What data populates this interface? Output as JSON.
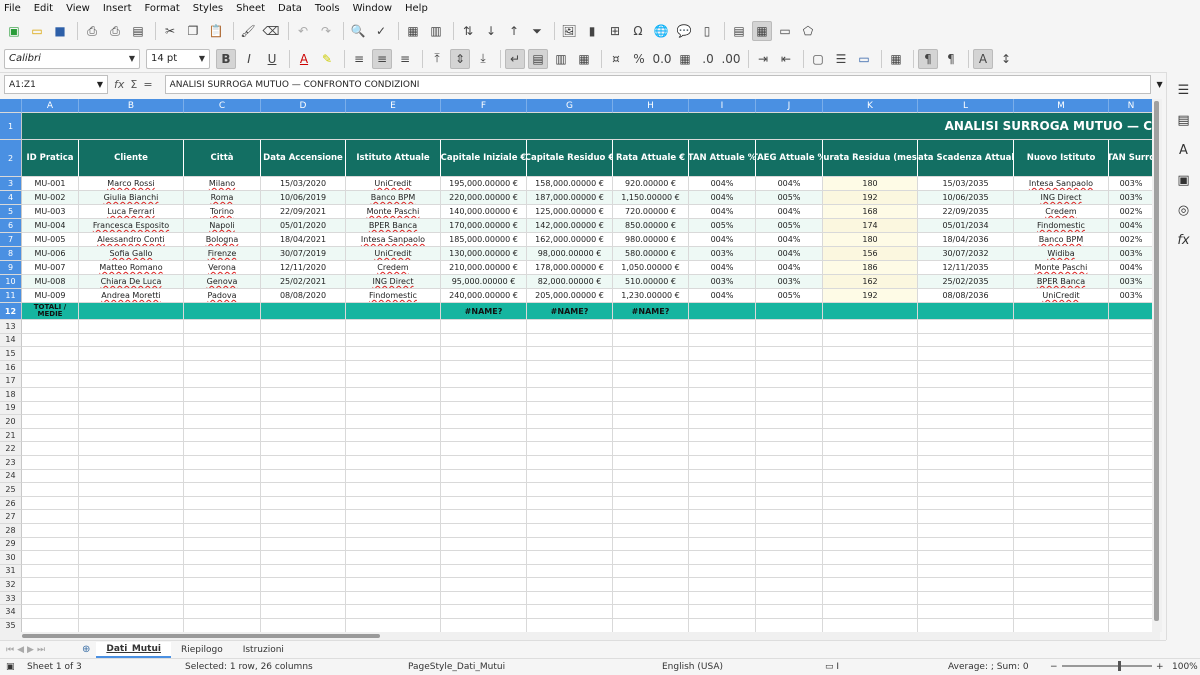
{
  "menu": [
    "File",
    "Edit",
    "View",
    "Insert",
    "Format",
    "Styles",
    "Sheet",
    "Data",
    "Tools",
    "Window",
    "Help"
  ],
  "format_bar": {
    "font_name": "Calibri",
    "font_size": "14 pt"
  },
  "formula_bar": {
    "cell_ref": "A1:Z1",
    "content": "ANALISI SURROGA MUTUO — CONFRONTO CONDIZIONI"
  },
  "columns": [
    "A",
    "B",
    "C",
    "D",
    "E",
    "F",
    "G",
    "H",
    "I",
    "J",
    "K",
    "L",
    "M",
    "N"
  ],
  "title": "ANALISI SURROGA MUTUO — C",
  "headers": [
    "ID Pratica",
    "Cliente",
    "Città",
    "Data Accensione",
    "Istituto Attuale",
    "Capitale Iniziale €",
    "Capitale Residuo €",
    "Rata Attuale €",
    "TAN Attuale %",
    "TAEG Attuale %",
    "Durata Residua (mesi)",
    "Data Scadenza Attuale",
    "Nuovo Istituto",
    "TAN Surro"
  ],
  "rows": [
    [
      "MU-001",
      "Marco Rossi",
      "Milano",
      "15/03/2020",
      "UniCredit",
      "195,000.00000 €",
      "158,000.00000 €",
      "920.00000 €",
      "004%",
      "004%",
      "180",
      "15/03/2035",
      "Intesa Sanpaolo",
      "003%"
    ],
    [
      "MU-002",
      "Giulia Bianchi",
      "Roma",
      "10/06/2019",
      "Banco BPM",
      "220,000.00000 €",
      "187,000.00000 €",
      "1,150.00000 €",
      "004%",
      "005%",
      "192",
      "10/06/2035",
      "ING Direct",
      "003%"
    ],
    [
      "MU-003",
      "Luca Ferrari",
      "Torino",
      "22/09/2021",
      "Monte Paschi",
      "140,000.00000 €",
      "125,000.00000 €",
      "720.00000 €",
      "004%",
      "004%",
      "168",
      "22/09/2035",
      "Credem",
      "002%"
    ],
    [
      "MU-004",
      "Francesca Esposito",
      "Napoli",
      "05/01/2020",
      "BPER Banca",
      "170,000.00000 €",
      "142,000.00000 €",
      "850.00000 €",
      "005%",
      "005%",
      "174",
      "05/01/2034",
      "Findomestic",
      "004%"
    ],
    [
      "MU-005",
      "Alessandro Conti",
      "Bologna",
      "18/04/2021",
      "Intesa Sanpaolo",
      "185,000.00000 €",
      "162,000.00000 €",
      "980.00000 €",
      "004%",
      "004%",
      "180",
      "18/04/2036",
      "Banco BPM",
      "002%"
    ],
    [
      "MU-006",
      "Sofia Gallo",
      "Firenze",
      "30/07/2019",
      "UniCredit",
      "130,000.00000 €",
      "98,000.00000 €",
      "580.00000 €",
      "003%",
      "004%",
      "156",
      "30/07/2032",
      "Widiba",
      "003%"
    ],
    [
      "MU-007",
      "Matteo Romano",
      "Verona",
      "12/11/2020",
      "Credem",
      "210,000.00000 €",
      "178,000.00000 €",
      "1,050.00000 €",
      "004%",
      "004%",
      "186",
      "12/11/2035",
      "Monte Paschi",
      "004%"
    ],
    [
      "MU-008",
      "Chiara De Luca",
      "Genova",
      "25/02/2021",
      "ING Direct",
      "95,000.00000 €",
      "82,000.00000 €",
      "510.00000 €",
      "003%",
      "003%",
      "162",
      "25/02/2035",
      "BPER Banca",
      "003%"
    ],
    [
      "MU-009",
      "Andrea Moretti",
      "Padova",
      "08/08/2020",
      "Findomestic",
      "240,000.00000 €",
      "205,000.00000 €",
      "1,230.00000 €",
      "004%",
      "005%",
      "192",
      "08/08/2036",
      "UniCredit",
      "003%"
    ]
  ],
  "totals_row": [
    "TOTALI / MEDIE",
    "",
    "",
    "",
    "",
    "#NAME?",
    "#NAME?",
    "#NAME?",
    "",
    "",
    "",
    "",
    "",
    ""
  ],
  "row_numbers": [
    "1",
    "2",
    "3",
    "4",
    "5",
    "6",
    "7",
    "8",
    "9",
    "10",
    "11",
    "12",
    "13",
    "14",
    "15",
    "16",
    "17",
    "18",
    "19",
    "20",
    "21",
    "22",
    "23",
    "24",
    "25",
    "26",
    "27",
    "28",
    "29",
    "30",
    "31",
    "32",
    "33",
    "34",
    "35"
  ],
  "sheets": [
    "Dati_Mutui",
    "Riepilogo",
    "Istruzioni"
  ],
  "active_sheet": "Dati_Mutui",
  "status": {
    "sheet": "Sheet 1 of 3",
    "selection": "Selected: 1 row, 26 columns",
    "page_style": "PageStyle_Dati_Mutui",
    "language": "English (USA)",
    "summary": "Average: ; Sum: 0",
    "zoom": "100%"
  },
  "colors": {
    "title_bg": "#136f63",
    "header_bg": "#136f63",
    "totals_bg": "#16b5a0",
    "col_head_bg": "#4a90e2",
    "alt_row": "#eef9f5",
    "highlight_col": "#fefbe6"
  }
}
